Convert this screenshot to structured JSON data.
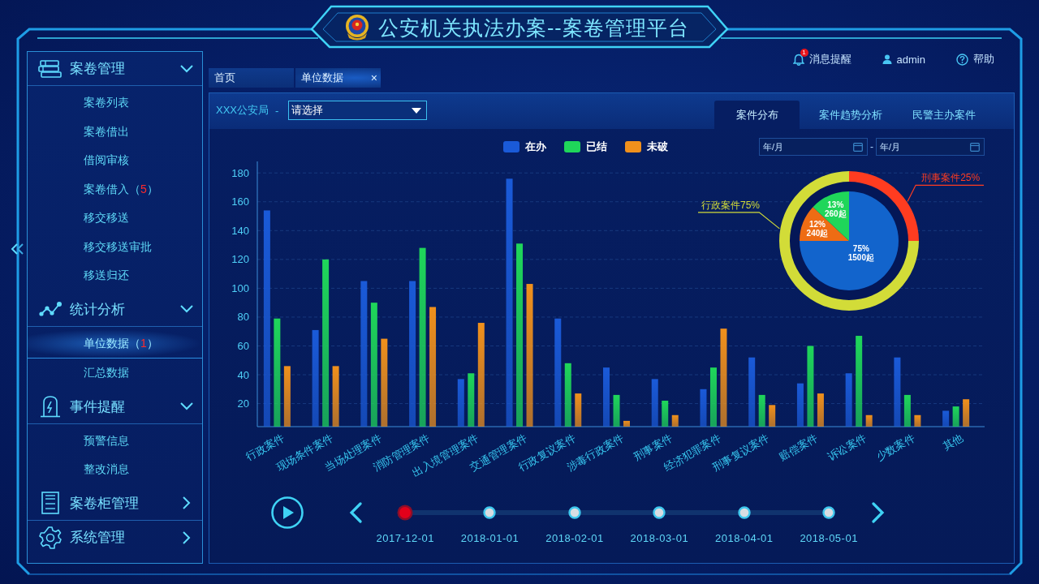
{
  "header": {
    "title": "公安机关执法办案--案卷管理平台"
  },
  "toolbar": [
    {
      "label": "消息提醒",
      "badge": "1"
    },
    {
      "label": "admin"
    },
    {
      "label": "帮助"
    }
  ],
  "sidebar": {
    "groups": [
      {
        "label": "案卷管理",
        "expanded": true,
        "items": [
          {
            "label": "案卷列表",
            "selected": false
          },
          {
            "label": "案卷借出",
            "selected": false
          },
          {
            "label": "借阅审核",
            "selected": false
          },
          {
            "label": "案卷借入",
            "count": {
              "open": "（",
              "value": "5",
              "close": "）"
            },
            "selected": false
          },
          {
            "label": "移交移送",
            "selected": false
          },
          {
            "label": "移交移送审批",
            "selected": false
          },
          {
            "label": "移送归还",
            "selected": false
          }
        ]
      },
      {
        "label": "统计分析",
        "expanded": true,
        "items": [
          {
            "label": "单位数据",
            "count": {
              "open": "（",
              "value": "1",
              "close": "）"
            },
            "selected": true
          },
          {
            "label": "汇总数据",
            "selected": false
          }
        ]
      },
      {
        "label": "事件提醒",
        "expanded": true,
        "items": [
          {
            "label": "预警信息",
            "selected": false
          },
          {
            "label": "整改消息",
            "selected": false
          }
        ]
      },
      {
        "label": "案卷柜管理",
        "expanded": false
      },
      {
        "label": "系统管理",
        "expanded": false
      }
    ]
  },
  "tabs": [
    {
      "label": "首页",
      "selected": false
    },
    {
      "label": "单位数据",
      "selected": true,
      "close": "×"
    }
  ],
  "panel": {
    "filter": {
      "label": "XXX公安局",
      "separator": "-",
      "select": {
        "placeholder": "请选择"
      }
    },
    "view_tabs": [
      {
        "label": "案件分布",
        "selected": true
      },
      {
        "label": "案件趋势分析",
        "selected": false
      },
      {
        "label": "民警主办案件",
        "selected": false
      }
    ],
    "date_range": {
      "start": {
        "placeholder": "年/月"
      },
      "separator": "-",
      "end": {
        "placeholder": "年/月"
      }
    },
    "chart_data": [
      {
        "type": "bar",
        "categories": [
          "行政案件",
          "现场条件案件",
          "当场处理案件",
          "消防管理案件",
          "出入境管理案件",
          "交通管理案件",
          "行政复议案件",
          "涉毒行政案件",
          "刑事案件",
          "经济犯罪案件",
          "刑事复议案件",
          "赔偿案件",
          "诉讼案件",
          "少数案件",
          "其他"
        ],
        "series": [
          {
            "name": "在办",
            "color": "#1a5ad8",
            "values": [
              154,
              71,
              105,
              105,
              37,
              176,
              79,
              45,
              37,
              30,
              52,
              34,
              41,
              52,
              15
            ]
          },
          {
            "name": "已结",
            "color": "#1fd65a",
            "values": [
              79,
              120,
              90,
              128,
              41,
              131,
              48,
              26,
              22,
              45,
              26,
              60,
              67,
              26,
              18
            ]
          },
          {
            "name": "未破",
            "color": "#f0901c",
            "values": [
              46,
              46,
              65,
              87,
              76,
              103,
              27,
              8,
              12,
              72,
              19,
              27,
              12,
              12,
              23
            ]
          }
        ],
        "yticks": [
          20,
          40,
          60,
          80,
          100,
          120,
          140,
          160,
          180
        ],
        "ylim": [
          4,
          188
        ],
        "legend": "top",
        "grid": true
      },
      {
        "type": "donut",
        "categories": [
          "刑事案件25%",
          "行政案件75%"
        ],
        "values": [
          25,
          75
        ],
        "colors": [
          "#ff3c20",
          "#d2dc38"
        ]
      },
      {
        "type": "pie",
        "values": [
          75,
          12,
          13
        ],
        "colors": [
          "#1264cc",
          "#ee6c14",
          "#1fd65a"
        ],
        "value_labels": [
          {
            "percent": "75%",
            "count": "1500起"
          },
          {
            "percent": "12%",
            "count": "240起"
          },
          {
            "percent": "13%",
            "count": "260起"
          }
        ]
      }
    ]
  },
  "timeline": {
    "points": [
      {
        "label": "2017-12-01",
        "selected": true
      },
      {
        "label": "2018-01-01",
        "selected": false
      },
      {
        "label": "2018-02-01",
        "selected": false
      },
      {
        "label": "2018-03-01",
        "selected": false
      },
      {
        "label": "2018-04-01",
        "selected": false
      },
      {
        "label": "2018-05-01",
        "selected": false
      }
    ]
  }
}
